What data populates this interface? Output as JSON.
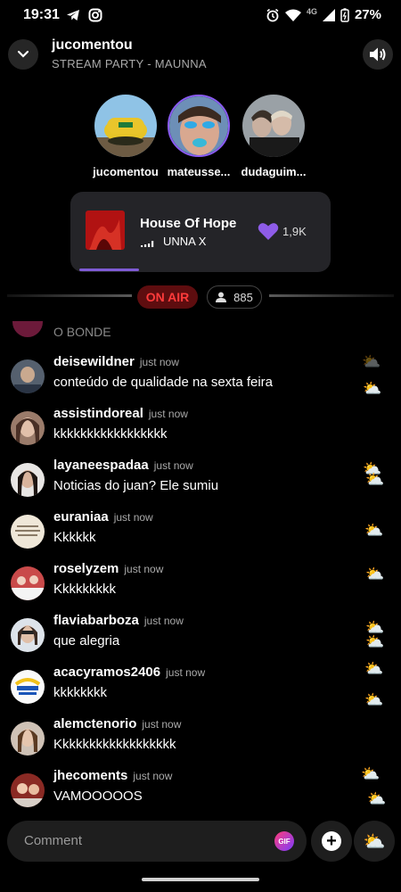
{
  "status_bar": {
    "time": "19:31",
    "network": "4G",
    "battery": "27%"
  },
  "header": {
    "title": "jucomentou",
    "subtitle": "STREAM PARTY - MAUNNA"
  },
  "participants": [
    {
      "name": "jucomentou"
    },
    {
      "name": "mateusse..."
    },
    {
      "name": "dudaguim..."
    }
  ],
  "now_playing": {
    "song": "House Of Hope",
    "artist": "UNNA X",
    "likes": "1,9K",
    "progress": 0.23
  },
  "live": {
    "on_air_label": "ON AIR",
    "viewers": "885"
  },
  "cut_comment": "O BONDE",
  "comments": [
    {
      "user": "deisewildner",
      "time": "just now",
      "text": "conteúdo de qualidade na sexta feira"
    },
    {
      "user": "assistindoreal",
      "time": "just now",
      "text": "kkkkkkkkkkkkkkkkk"
    },
    {
      "user": "layaneespadaa",
      "time": "just now",
      "text": "Noticias do juan? Ele sumiu"
    },
    {
      "user": "euraniaa",
      "time": "just now",
      "text": "Kkkkkk"
    },
    {
      "user": "roselyzem",
      "time": "just now",
      "text": "Kkkkkkkkk"
    },
    {
      "user": "flaviabarboza",
      "time": "just now",
      "text": "que alegria"
    },
    {
      "user": "acacyramos2406",
      "time": "just now",
      "text": "kkkkkkkk"
    },
    {
      "user": "alemctenorio",
      "time": "just now",
      "text": "Kkkkkkkkkkkkkkkkkk"
    },
    {
      "user": "jhecoments",
      "time": "just now",
      "text": "VAMOOOOOS"
    }
  ],
  "composer": {
    "placeholder": "Comment",
    "gif_label": "GIF"
  },
  "icons": {
    "back": "chevron-down-icon",
    "sound": "speaker-icon",
    "heart": "heart-icon",
    "viewers": "person-icon",
    "add": "plus-circle-icon",
    "weather": "sun-behind-cloud-icon"
  },
  "colors": {
    "accent": "#7f5bd5",
    "live_red": "#ff3b3b",
    "heart": "#8e5ce8"
  }
}
